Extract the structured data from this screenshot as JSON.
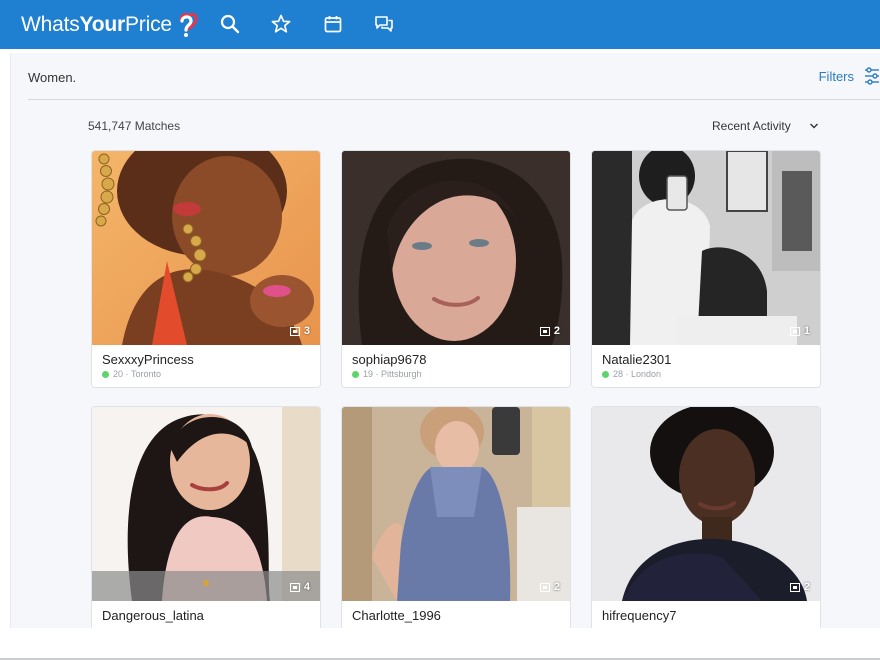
{
  "brand": {
    "logo_thin": "Whats",
    "logo_bold": "Your",
    "logo_tail": "Price",
    "color_header": "#1f7fd1",
    "color_accent": "#2a7bc0",
    "color_logo_heart": "#e8364b"
  },
  "nav": {
    "icons": [
      "search-icon",
      "star-icon",
      "calendar-icon",
      "chat-icon"
    ]
  },
  "page": {
    "breadcrumb": "Women.",
    "filters_label": "Filters",
    "filters_icon": "sliders-icon",
    "matches_text": "541,747 Matches",
    "sort_label": "Recent Activity",
    "sort_icon": "chevron-down-icon"
  },
  "cards": [
    {
      "username": "SexxxyPrincess",
      "age": "20",
      "city": "Toronto",
      "photo_count": "3",
      "online": true
    },
    {
      "username": "sophiap9678",
      "age": "19",
      "city": "Pittsburgh",
      "photo_count": "2",
      "online": true
    },
    {
      "username": "Natalie2301",
      "age": "28",
      "city": "London",
      "photo_count": "1",
      "online": true
    },
    {
      "username": "Dangerous_latina",
      "photo_count": "4"
    },
    {
      "username": "Charlotte_1996",
      "photo_count": "2"
    },
    {
      "username": "hifrequency7",
      "photo_count": "2"
    }
  ]
}
